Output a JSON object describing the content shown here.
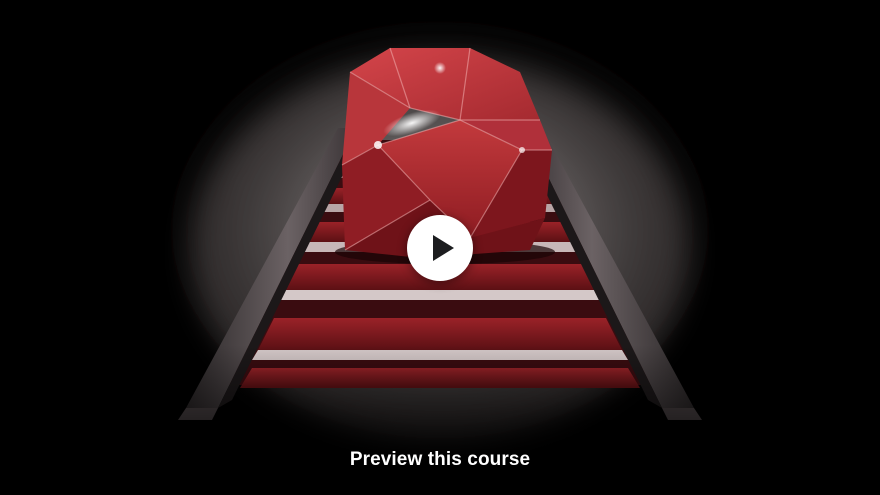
{
  "preview": {
    "label": "Preview this course",
    "thumbnail_subject": "ruby-gem-on-rails",
    "play_icon": "play-icon"
  },
  "colors": {
    "background": "#000000",
    "ruby": "#a52a2a",
    "play_button": "#ffffff",
    "play_glyph": "#1c1d1f",
    "label_text": "#ffffff"
  }
}
